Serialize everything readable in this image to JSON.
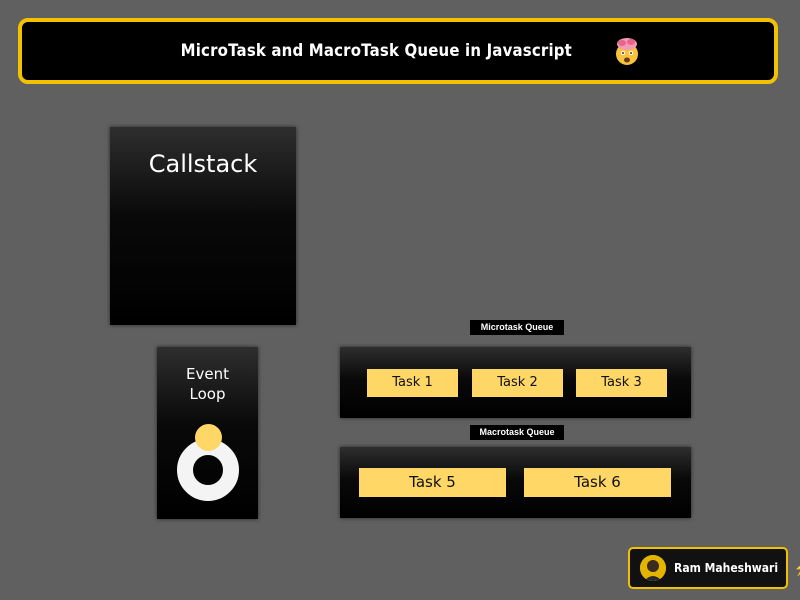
{
  "header": {
    "title": "MicroTask and MacroTask Queue in Javascript",
    "emoji_icon": "exploding-head-icon",
    "border_color": "#f2c200"
  },
  "callstack": {
    "title": "Callstack"
  },
  "event_loop": {
    "label_line1": "Event",
    "label_line2": "Loop",
    "ring_color": "#f4f4f4",
    "dot_color": "#fed767"
  },
  "microtask_queue": {
    "label": "Microtask Queue",
    "tasks": [
      "Task 1",
      "Task 2",
      "Task 3"
    ]
  },
  "macrotask_queue": {
    "label": "Macrotask Queue",
    "tasks": [
      "Task 5",
      "Task 6"
    ]
  },
  "author": {
    "name": "Ram Maheshwari",
    "icon": "lightning-bolt-icon"
  },
  "colors": {
    "background": "#606060",
    "task_fill": "#fed767",
    "accent": "#f2c200"
  }
}
